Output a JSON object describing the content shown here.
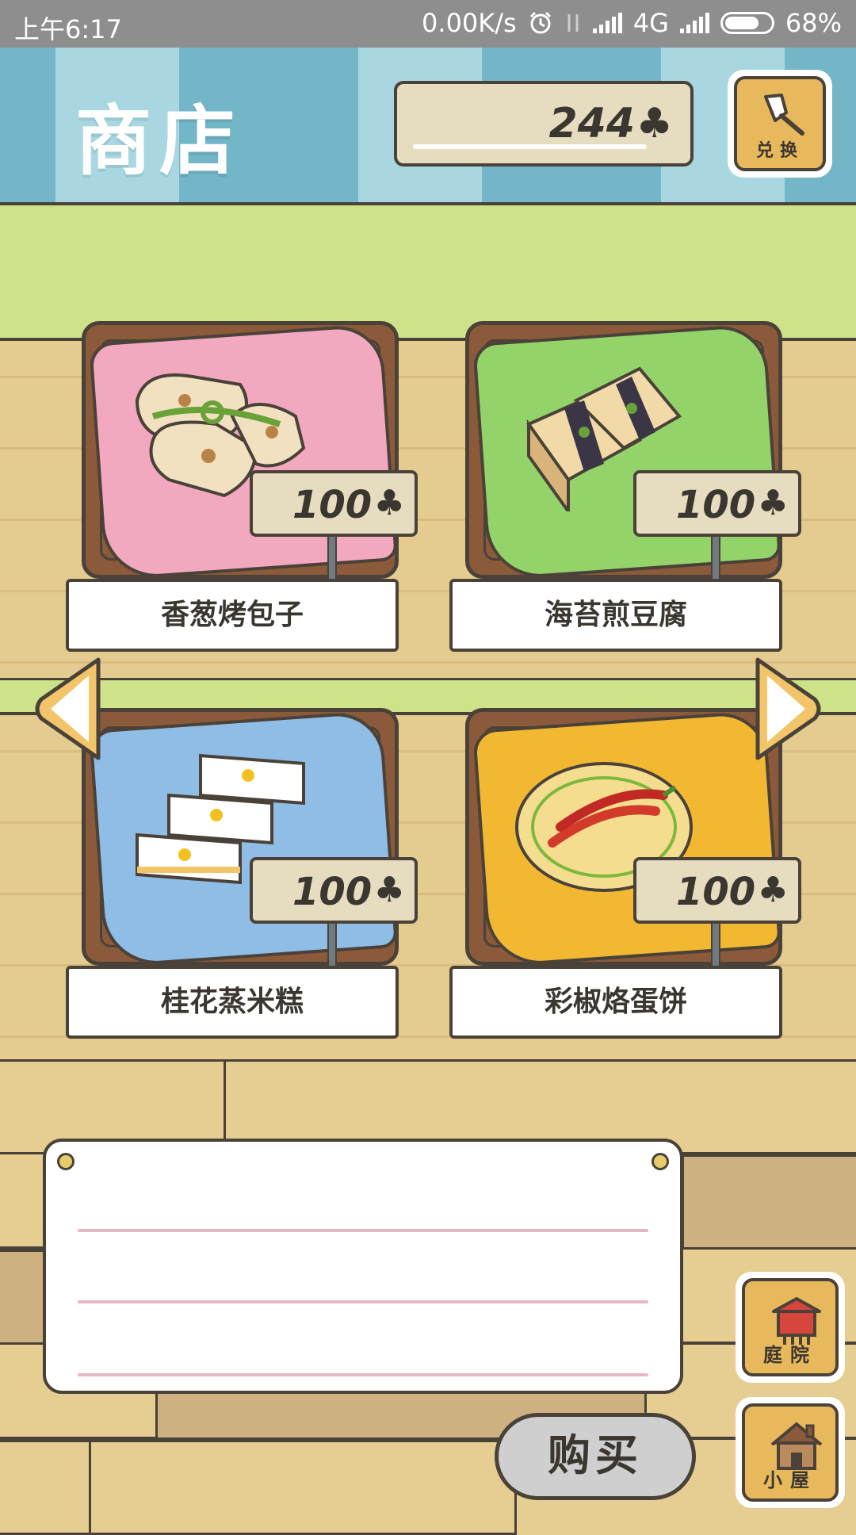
{
  "status_bar": {
    "time": "上午6:17",
    "network_speed": "0.00K/s",
    "network_type": "4G",
    "battery": "68%"
  },
  "header": {
    "title": "商店",
    "clover_count": "244",
    "exchange_label": "兑换"
  },
  "items": [
    {
      "name": "香葱烤包子",
      "price": "100",
      "cloth_color": "#f2a9c0"
    },
    {
      "name": "海苔煎豆腐",
      "price": "100",
      "cloth_color": "#94d36a"
    },
    {
      "name": "桂花蒸米糕",
      "price": "100",
      "cloth_color": "#8fbde6"
    },
    {
      "name": "彩椒烙蛋饼",
      "price": "100",
      "cloth_color": "#f3b832"
    }
  ],
  "buy_label": "购买",
  "nav": {
    "yard_label": "庭院",
    "house_label": "小屋"
  },
  "colors": {
    "outline": "#4a4238",
    "wood": "#e4cb8f",
    "green": "#cde289",
    "stripe_dark": "#72b6c8",
    "stripe_light": "#a8d7e1",
    "button_orange": "#e8b95c"
  }
}
